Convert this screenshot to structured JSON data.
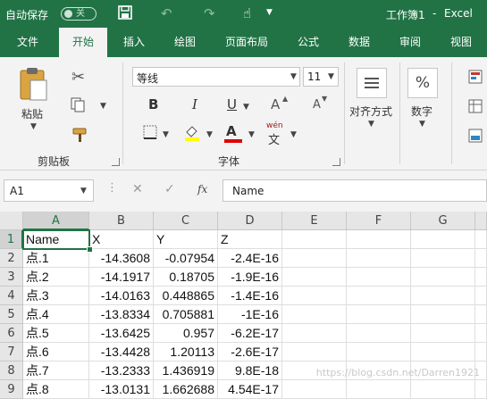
{
  "title_bar": {
    "autosave_label": "自动保存",
    "autosave_state": "关",
    "doc_title": "工作簿1",
    "app_name": "Excel",
    "separator": "-"
  },
  "tabs": [
    {
      "label": "文件",
      "active": false
    },
    {
      "label": "开始",
      "active": true
    },
    {
      "label": "插入",
      "active": false
    },
    {
      "label": "绘图",
      "active": false
    },
    {
      "label": "页面布局",
      "active": false
    },
    {
      "label": "公式",
      "active": false
    },
    {
      "label": "数据",
      "active": false
    },
    {
      "label": "审阅",
      "active": false
    },
    {
      "label": "视图",
      "active": false
    }
  ],
  "ribbon": {
    "clipboard": {
      "paste_label": "粘贴",
      "group_label": "剪贴板"
    },
    "font": {
      "font_name": "等线",
      "font_size": "11",
      "bold": "B",
      "italic": "I",
      "underline": "U",
      "grow": "A",
      "shrink": "A",
      "phonetic": "wén",
      "phonetic_sub": "文",
      "group_label": "字体"
    },
    "alignment": {
      "label": "对齐方式"
    },
    "number": {
      "label": "数字",
      "symbol": "%"
    }
  },
  "formula_bar": {
    "name_box": "A1",
    "fx": "fx",
    "formula": "Name"
  },
  "grid": {
    "columns": [
      "A",
      "B",
      "C",
      "D",
      "E",
      "F",
      "G"
    ],
    "selected_column": "A",
    "selected_row": "1",
    "rows": [
      {
        "row": "1",
        "cells": [
          "Name",
          "X",
          "Y",
          "Z"
        ]
      },
      {
        "row": "2",
        "cells": [
          "点.1",
          "-14.3608",
          "-0.07954",
          "-2.4E-16"
        ]
      },
      {
        "row": "3",
        "cells": [
          "点.2",
          "-14.1917",
          "0.18705",
          "-1.9E-16"
        ]
      },
      {
        "row": "4",
        "cells": [
          "点.3",
          "-14.0163",
          "0.448865",
          "-1.4E-16"
        ]
      },
      {
        "row": "5",
        "cells": [
          "点.4",
          "-13.8334",
          "0.705881",
          "-1E-16"
        ]
      },
      {
        "row": "6",
        "cells": [
          "点.5",
          "-13.6425",
          "0.957",
          "-6.2E-17"
        ]
      },
      {
        "row": "7",
        "cells": [
          "点.6",
          "-13.4428",
          "1.20113",
          "-2.6E-17"
        ]
      },
      {
        "row": "8",
        "cells": [
          "点.7",
          "-13.2333",
          "1.436919",
          "9.8E-18"
        ]
      },
      {
        "row": "9",
        "cells": [
          "点.8",
          "-13.0131",
          "1.662688",
          "4.54E-17"
        ]
      }
    ]
  },
  "watermark": "https://blog.csdn.net/Darren1921",
  "colors": {
    "accent": "#217346",
    "font_highlight": "#ffff00",
    "font_color": "#e00000"
  }
}
